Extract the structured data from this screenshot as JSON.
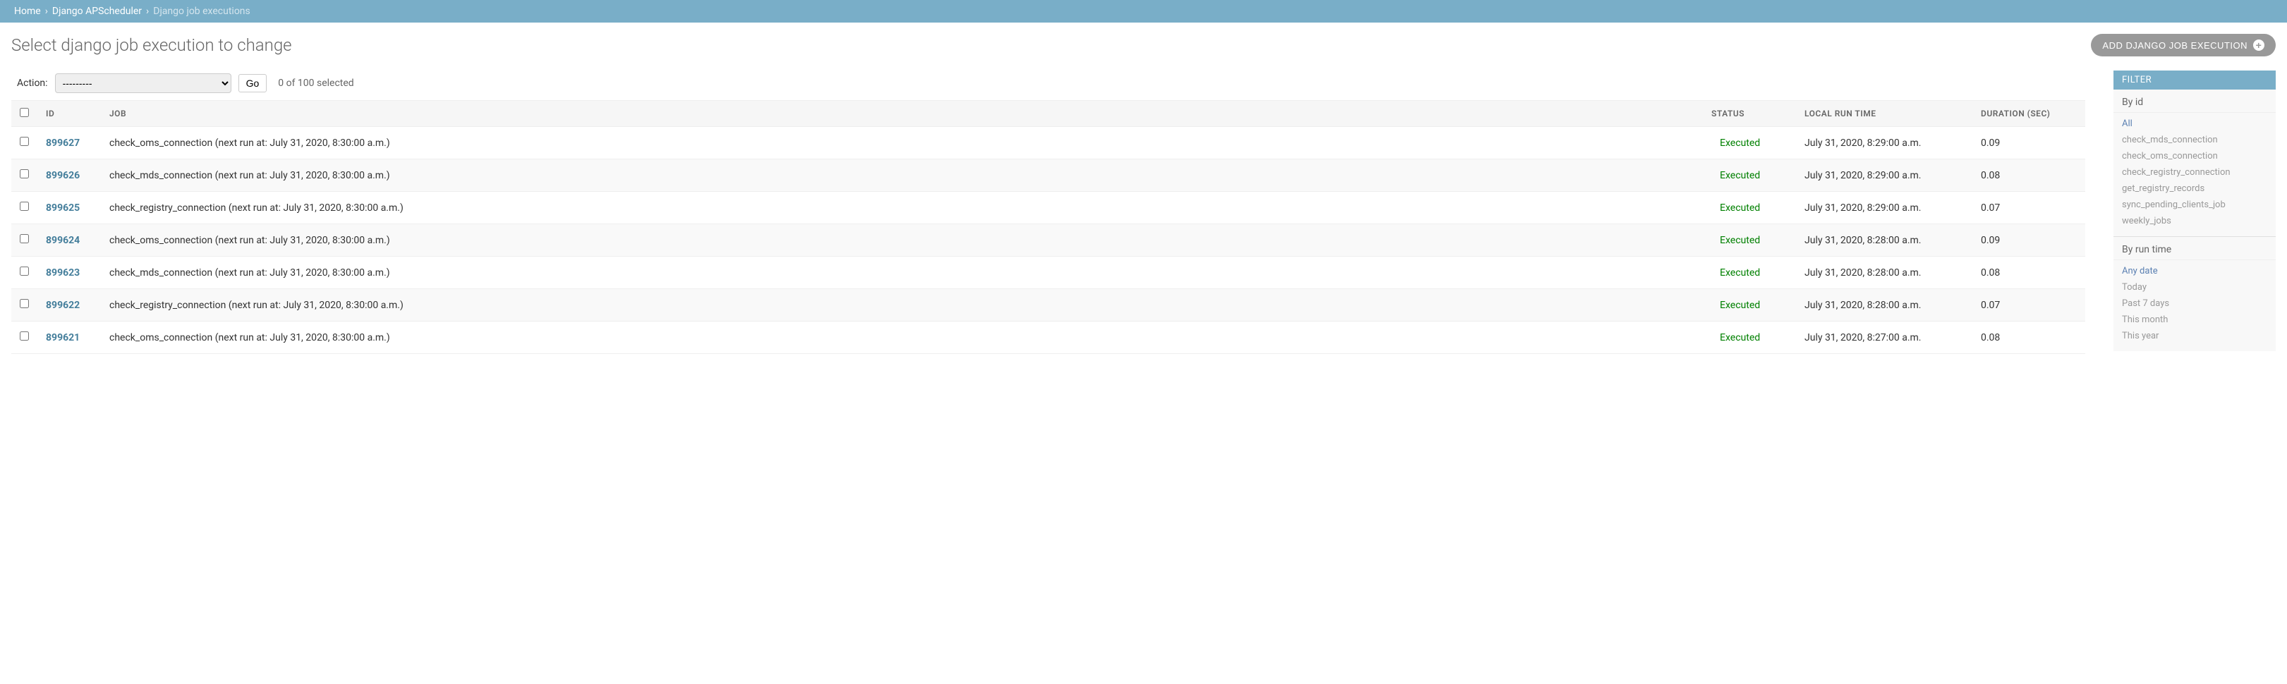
{
  "breadcrumb": {
    "home": "Home",
    "app": "Django APScheduler",
    "current": "Django job executions"
  },
  "page_title": "Select django job execution to change",
  "add_button_label": "ADD DJANGO JOB EXECUTION",
  "action_bar": {
    "label": "Action:",
    "placeholder": "---------",
    "go_label": "Go",
    "selection_count": "0 of 100 selected"
  },
  "columns": {
    "id": "ID",
    "job": "JOB",
    "status": "STATUS",
    "runtime": "LOCAL RUN TIME",
    "duration": "DURATION (SEC)"
  },
  "rows": [
    {
      "id": "899627",
      "job": "check_oms_connection (next run at: July 31, 2020, 8:30:00 a.m.)",
      "status": "Executed",
      "runtime": "July 31, 2020, 8:29:00 a.m.",
      "duration": "0.09"
    },
    {
      "id": "899626",
      "job": "check_mds_connection (next run at: July 31, 2020, 8:30:00 a.m.)",
      "status": "Executed",
      "runtime": "July 31, 2020, 8:29:00 a.m.",
      "duration": "0.08"
    },
    {
      "id": "899625",
      "job": "check_registry_connection (next run at: July 31, 2020, 8:30:00 a.m.)",
      "status": "Executed",
      "runtime": "July 31, 2020, 8:29:00 a.m.",
      "duration": "0.07"
    },
    {
      "id": "899624",
      "job": "check_oms_connection (next run at: July 31, 2020, 8:30:00 a.m.)",
      "status": "Executed",
      "runtime": "July 31, 2020, 8:28:00 a.m.",
      "duration": "0.09"
    },
    {
      "id": "899623",
      "job": "check_mds_connection (next run at: July 31, 2020, 8:30:00 a.m.)",
      "status": "Executed",
      "runtime": "July 31, 2020, 8:28:00 a.m.",
      "duration": "0.08"
    },
    {
      "id": "899622",
      "job": "check_registry_connection (next run at: July 31, 2020, 8:30:00 a.m.)",
      "status": "Executed",
      "runtime": "July 31, 2020, 8:28:00 a.m.",
      "duration": "0.07"
    },
    {
      "id": "899621",
      "job": "check_oms_connection (next run at: July 31, 2020, 8:30:00 a.m.)",
      "status": "Executed",
      "runtime": "July 31, 2020, 8:27:00 a.m.",
      "duration": "0.08"
    }
  ],
  "filter": {
    "title": "FILTER",
    "groups": [
      {
        "title": "By id",
        "items": [
          {
            "label": "All",
            "selected": true
          },
          {
            "label": "check_mds_connection",
            "selected": false
          },
          {
            "label": "check_oms_connection",
            "selected": false
          },
          {
            "label": "check_registry_connection",
            "selected": false
          },
          {
            "label": "get_registry_records",
            "selected": false
          },
          {
            "label": "sync_pending_clients_job",
            "selected": false
          },
          {
            "label": "weekly_jobs",
            "selected": false
          }
        ]
      },
      {
        "title": "By run time",
        "items": [
          {
            "label": "Any date",
            "selected": true
          },
          {
            "label": "Today",
            "selected": false
          },
          {
            "label": "Past 7 days",
            "selected": false
          },
          {
            "label": "This month",
            "selected": false
          },
          {
            "label": "This year",
            "selected": false
          }
        ]
      }
    ]
  }
}
